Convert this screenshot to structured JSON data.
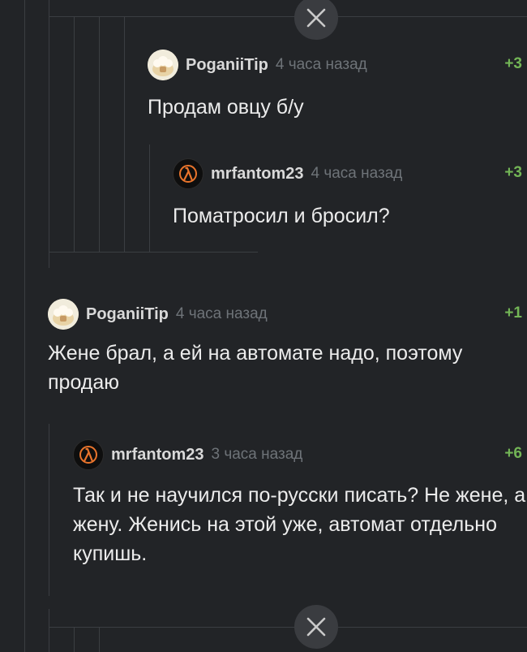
{
  "comments": [
    {
      "user": "PoganiiTip",
      "time": "4 часа назад",
      "rating": "+3",
      "text": "Продам овцу б/у",
      "avatar": "sheep-avatar"
    },
    {
      "user": "mrfantom23",
      "time": "4 часа назад",
      "rating": "+3",
      "text": "Поматросил и бросил?",
      "avatar": "half-life-lambda-avatar"
    },
    {
      "user": "PoganiiTip",
      "time": "4 часа назад",
      "rating": "+1",
      "text": "Жене брал, а ей на автомате надо, поэтому продаю",
      "avatar": "sheep-avatar"
    },
    {
      "user": "mrfantom23",
      "time": "3 часа назад",
      "rating": "+6",
      "text": "Так и не научился по-русски писать? Не жене, а жену. Женись на этой уже, автомат отдельно купишь.",
      "avatar": "half-life-lambda-avatar"
    }
  ],
  "colors": {
    "background": "#222427",
    "rating": "#73b556",
    "muted": "#6e7378",
    "thread_line": "#3b3e42"
  }
}
